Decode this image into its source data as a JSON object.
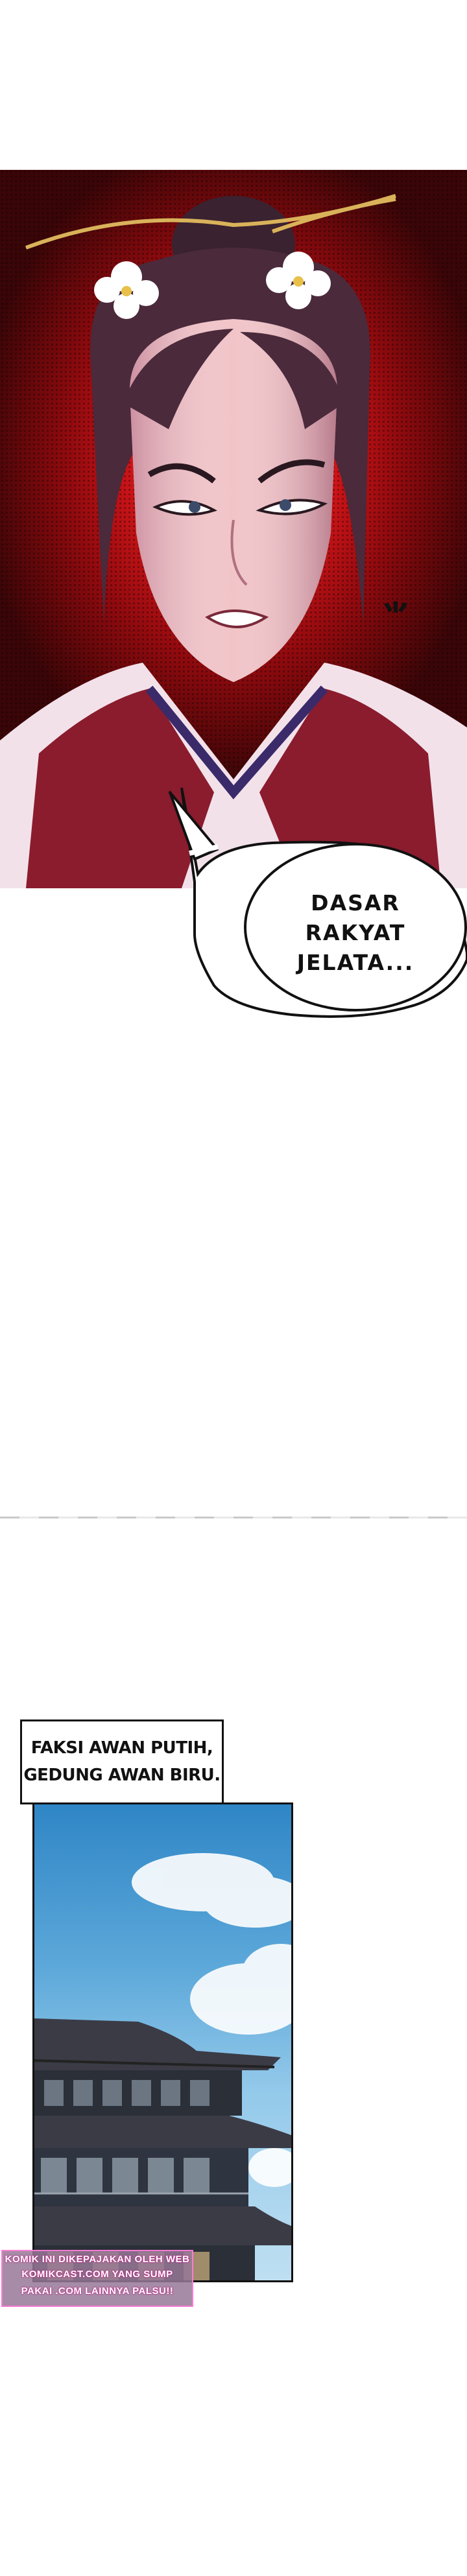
{
  "speech_bubble": {
    "line1": "DASAR",
    "line2": "RAKYAT",
    "line3": "JELATA..."
  },
  "caption": {
    "line1": "FAKSI AWAN PUTIH,",
    "line2": "GEDUNG AWAN BIRU."
  },
  "watermark": {
    "line1": "KOMIK INI DIKEPAJAKAN OLEH WEB",
    "line2": "KOMIKCAST.COM YANG SUMP",
    "line3": "PAKAI .COM LAINNYA PALSU!!"
  },
  "colors": {
    "panel1_background": "#d8161a",
    "sky": "#5ea9da",
    "roof": "#3b3b46",
    "watermark_border": "#ff7ad5"
  }
}
